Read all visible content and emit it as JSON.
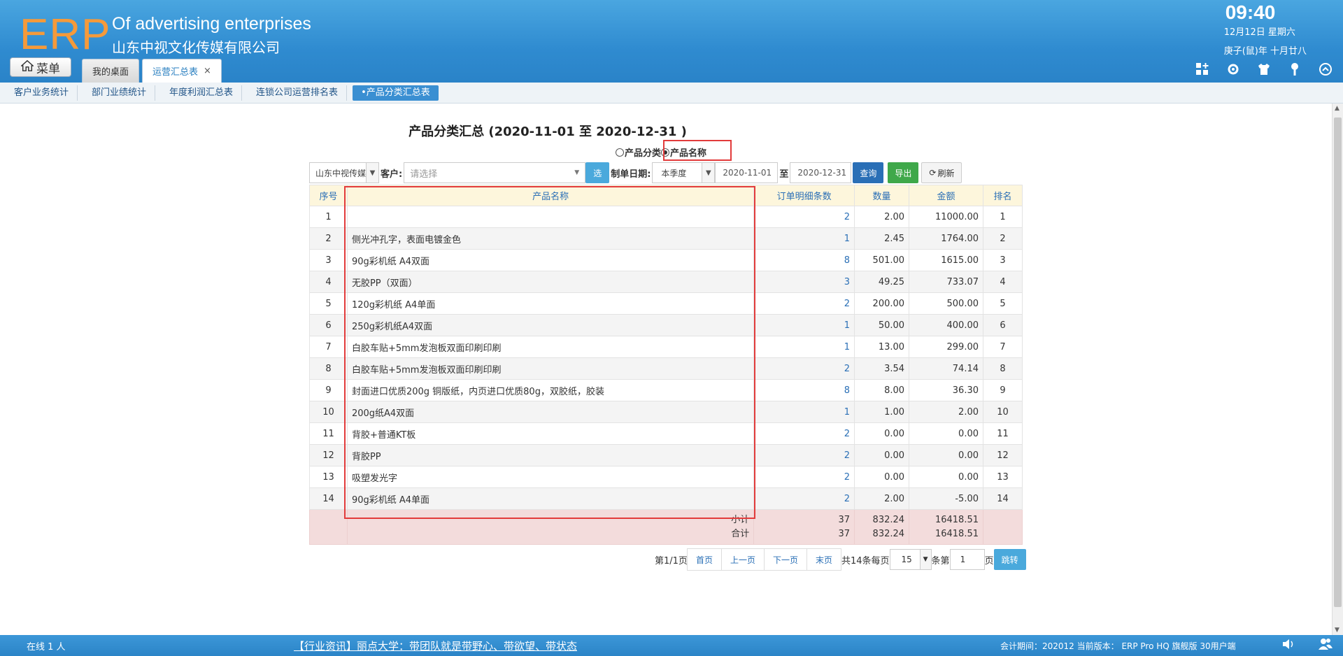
{
  "header": {
    "logo": "ERP",
    "brand_en": "Of advertising enterprises",
    "brand_cn": "山东中视文化传媒有限公司",
    "time": "09:40",
    "date": "12月12日 星期六",
    "lunar": "庚子(鼠)年 十月廿八",
    "menu_label": "菜单",
    "tabs": [
      {
        "label": "我的桌面"
      },
      {
        "label": "运营汇总表",
        "close": "×"
      }
    ],
    "tool_icons": [
      "grid-add-icon",
      "gear-icon",
      "shirt-icon",
      "key-icon",
      "collapse-icon"
    ]
  },
  "subnav": {
    "items": [
      "客户业务统计",
      "部门业绩统计",
      "年度利润汇总表",
      "连锁公司运营排名表",
      "•产品分类汇总表"
    ]
  },
  "report": {
    "title": "产品分类汇总 (2020-11-01 至 2020-12-31 )",
    "radio_category": "产品分类",
    "radio_name": "产品名称"
  },
  "filters": {
    "company": "山东中视传媒",
    "customer_label": "客户:",
    "customer_placeholder": "请选择",
    "select_btn": "选",
    "date_label": "制单日期:",
    "period": "本季度",
    "date_from": "2020-11-01",
    "to_label": "至",
    "date_to": "2020-12-31",
    "query_btn": "查询",
    "export_btn": "导出",
    "refresh_btn": "刷新"
  },
  "table": {
    "headers": [
      "序号",
      "产品名称",
      "订单明细条数",
      "数量",
      "金额",
      "排名"
    ],
    "rows": [
      {
        "no": "1",
        "name": "",
        "count": "2",
        "qty": "2.00",
        "amount": "11000.00",
        "rank": "1"
      },
      {
        "no": "2",
        "name": "侧光冲孔字，表面电镀金色",
        "count": "1",
        "qty": "2.45",
        "amount": "1764.00",
        "rank": "2"
      },
      {
        "no": "3",
        "name": "90g彩机纸 A4双面",
        "count": "8",
        "qty": "501.00",
        "amount": "1615.00",
        "rank": "3"
      },
      {
        "no": "4",
        "name": "无胶PP（双面）",
        "count": "3",
        "qty": "49.25",
        "amount": "733.07",
        "rank": "4"
      },
      {
        "no": "5",
        "name": "120g彩机纸 A4单面",
        "count": "2",
        "qty": "200.00",
        "amount": "500.00",
        "rank": "5"
      },
      {
        "no": "6",
        "name": "250g彩机纸A4双面",
        "count": "1",
        "qty": "50.00",
        "amount": "400.00",
        "rank": "6"
      },
      {
        "no": "7",
        "name": "白胶车贴+5mm发泡板双面印刷印刷",
        "count": "1",
        "qty": "13.00",
        "amount": "299.00",
        "rank": "7"
      },
      {
        "no": "8",
        "name": "白胶车贴+5mm发泡板双面印刷印刷",
        "count": "2",
        "qty": "3.54",
        "amount": "74.14",
        "rank": "8"
      },
      {
        "no": "9",
        "name": "封面进口优质200g 铜版纸，内页进口优质80g，双胶纸，胶装",
        "count": "8",
        "qty": "8.00",
        "amount": "36.30",
        "rank": "9"
      },
      {
        "no": "10",
        "name": "200g纸A4双面",
        "count": "1",
        "qty": "1.00",
        "amount": "2.00",
        "rank": "10"
      },
      {
        "no": "11",
        "name": "背胶+普通KT板",
        "count": "2",
        "qty": "0.00",
        "amount": "0.00",
        "rank": "11"
      },
      {
        "no": "12",
        "name": "背胶PP",
        "count": "2",
        "qty": "0.00",
        "amount": "0.00",
        "rank": "12"
      },
      {
        "no": "13",
        "name": "吸塑发光字",
        "count": "2",
        "qty": "0.00",
        "amount": "0.00",
        "rank": "13"
      },
      {
        "no": "14",
        "name": "90g彩机纸 A4单面",
        "count": "2",
        "qty": "2.00",
        "amount": "-5.00",
        "rank": "14"
      }
    ],
    "subtotal": {
      "label": "小计",
      "count": "37",
      "qty": "832.24",
      "amount": "16418.51"
    },
    "total": {
      "label": "合计",
      "count": "37",
      "qty": "832.24",
      "amount": "16418.51"
    }
  },
  "pager": {
    "page_info": "第1/1页",
    "first": "首页",
    "prev": "上一页",
    "next": "下一页",
    "last": "末页",
    "total_label": "共14条每页",
    "page_size": "15",
    "goto_label": "条第",
    "page_input": "1",
    "page_unit": "页",
    "jump": "跳转"
  },
  "footer": {
    "online": "在线  1  人",
    "news": "【行业资讯】丽点大学：带团队就是带野心、带欲望、带状态",
    "version": "会计期间：202012 当前版本： ERP Pro HQ 旗舰版 30用户端"
  }
}
